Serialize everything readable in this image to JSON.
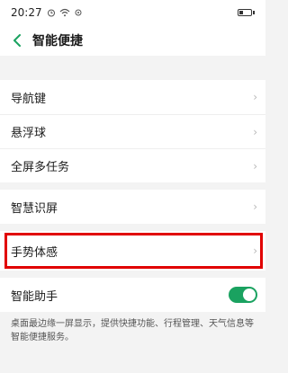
{
  "status": {
    "time": "20:27",
    "icons": [
      "alarm-icon",
      "wifi-icon",
      "battery-icon"
    ],
    "extra": "॒ ◇"
  },
  "header": {
    "title": "智能便捷"
  },
  "groups": [
    {
      "items": [
        {
          "label": "导航键",
          "chevron": "›"
        },
        {
          "label": "悬浮球",
          "chevron": "›"
        },
        {
          "label": "全屏多任务",
          "chevron": "›"
        }
      ]
    },
    {
      "items": [
        {
          "label": "智慧识屏",
          "chevron": "›"
        }
      ]
    },
    {
      "items": [
        {
          "label": "手势体感",
          "chevron": "›",
          "highlighted": true
        }
      ]
    },
    {
      "items": [
        {
          "label": "智能助手",
          "toggle": true,
          "on": true
        }
      ]
    }
  ],
  "description": "桌面最边缘一屏显示，提供快捷功能、行程管理、天气信息等智能便捷服务。",
  "colors": {
    "accent": "#1aa260",
    "highlight_border": "#e10000"
  }
}
